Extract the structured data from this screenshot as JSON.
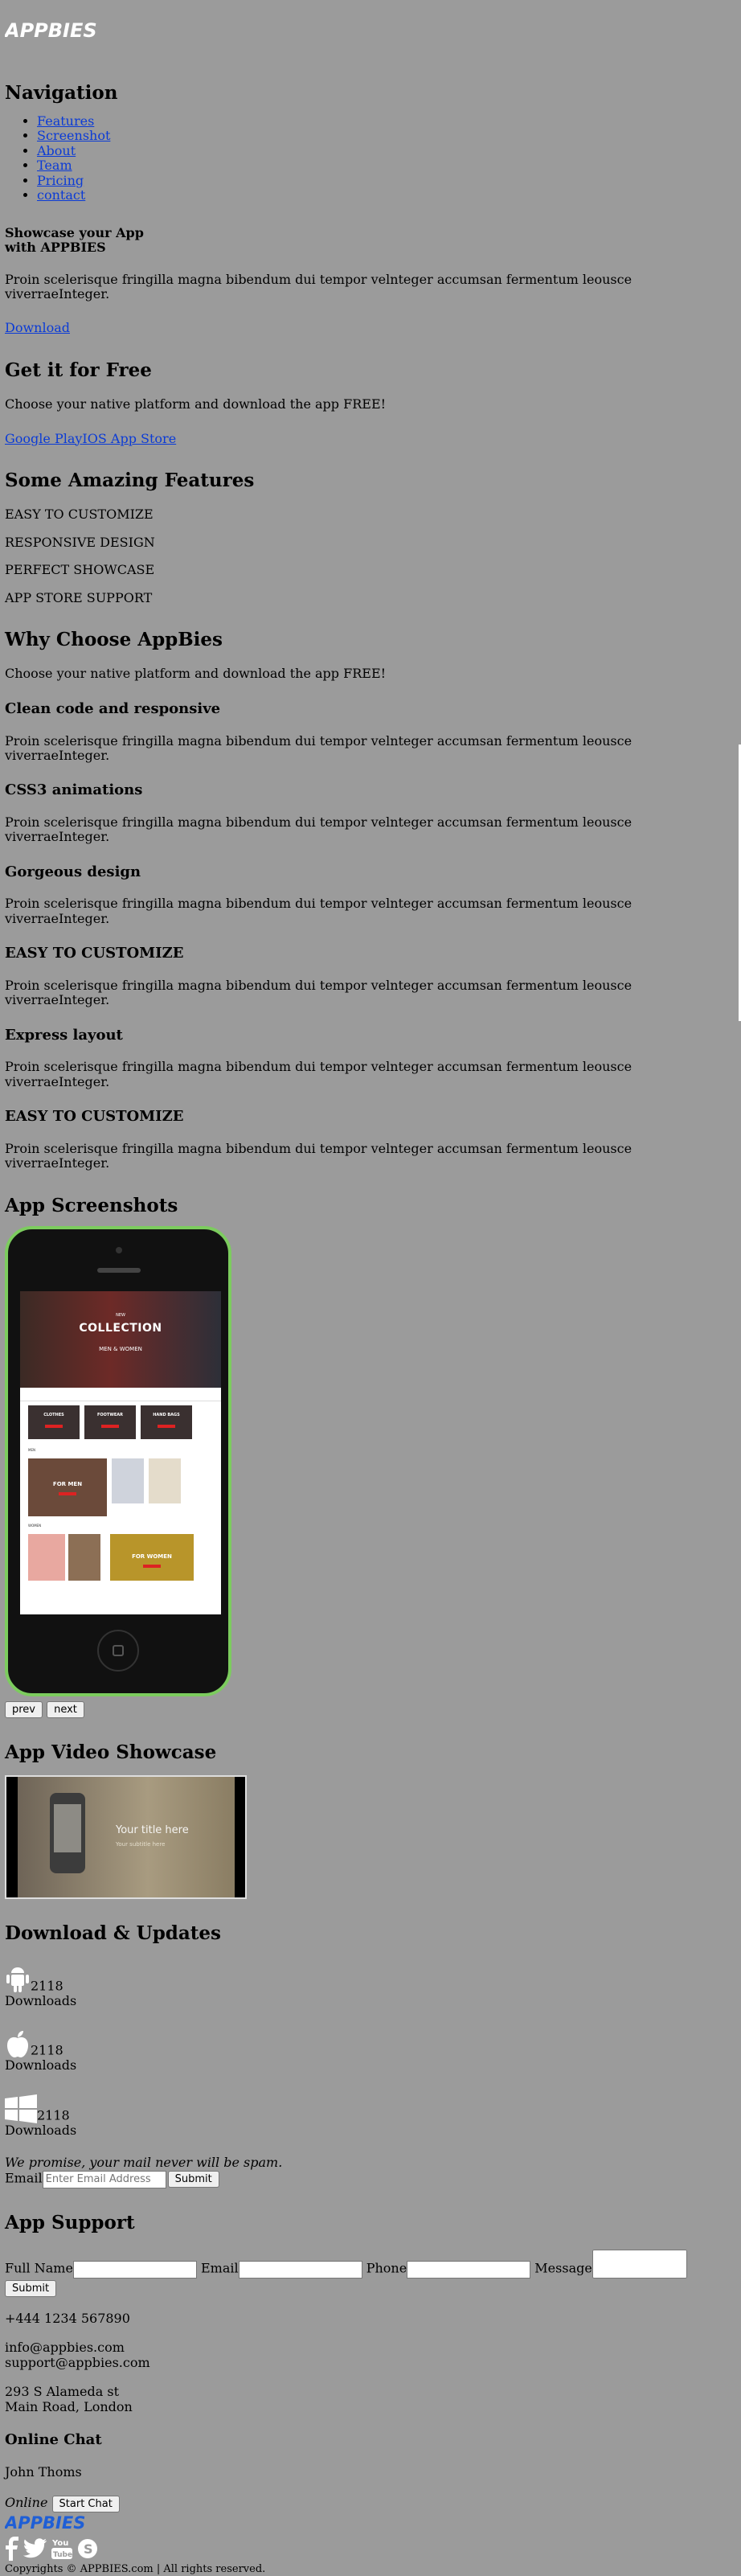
{
  "brand": {
    "name": "APPBIES"
  },
  "nav": {
    "heading": "Navigation",
    "items": [
      "Features",
      "Screenshot",
      "About",
      "Team",
      "Pricing",
      "contact"
    ]
  },
  "hero": {
    "title_line1": "Showcase your App",
    "title_line2": "with APPBIES",
    "text": "Proin scelerisque fringilla magna bibendum dui tempor velnteger accumsan fermentum leousce viverraeInteger.",
    "download_label": "Download"
  },
  "free": {
    "heading": "Get it for Free",
    "text": "Choose your native platform and download the app FREE!",
    "google_label": "Google Play",
    "ios_label": "IOS App Store"
  },
  "features": {
    "heading": "Some Amazing Features",
    "items": [
      "EASY TO CUSTOMIZE",
      "RESPONSIVE DESIGN",
      "PERFECT SHOWCASE",
      "APP STORE SUPPORT"
    ]
  },
  "why": {
    "heading": "Why Choose AppBies",
    "text": "Choose your native platform and download the app FREE!",
    "items": [
      {
        "title": "Clean code and responsive",
        "text": "Proin scelerisque fringilla magna bibendum dui tempor velnteger accumsan fermentum leousce viverraeInteger."
      },
      {
        "title": "CSS3 animations",
        "text": "Proin scelerisque fringilla magna bibendum dui tempor velnteger accumsan fermentum leousce viverraeInteger."
      },
      {
        "title": "Gorgeous design",
        "text": "Proin scelerisque fringilla magna bibendum dui tempor velnteger accumsan fermentum leousce viverraeInteger."
      },
      {
        "title": "EASY TO CUSTOMIZE",
        "text": "Proin scelerisque fringilla magna bibendum dui tempor velnteger accumsan fermentum leousce viverraeInteger."
      },
      {
        "title": "Express layout",
        "text": "Proin scelerisque fringilla magna bibendum dui tempor velnteger accumsan fermentum leousce viverraeInteger."
      },
      {
        "title": "EASY TO CUSTOMIZE",
        "text": "Proin scelerisque fringilla magna bibendum dui tempor velnteger accumsan fermentum leousce viverraeInteger."
      }
    ]
  },
  "screenshots": {
    "heading": "App Screenshots",
    "banner_small": "NEW",
    "banner_title": "COLLECTION",
    "banner_sub": "MEN & WOMEN",
    "tile1": "CLOTHES",
    "tile2": "FOOTWEAR",
    "tile3": "HAND BAGS",
    "for_men": "FOR MEN",
    "for_women": "FOR WOMEN",
    "men_label": "MEN",
    "women_label": "WOMEN",
    "prev_label": "prev",
    "next_label": "next"
  },
  "video": {
    "heading": "App Video Showcase",
    "title": "Your title here",
    "subtitle": "Your subtitle here"
  },
  "downloads": {
    "heading": "Download & Updates",
    "items": [
      {
        "icon": "android-icon",
        "count": "2118",
        "label": "Downloads"
      },
      {
        "icon": "apple-icon",
        "count": "2118",
        "label": "Downloads"
      },
      {
        "icon": "windows-icon",
        "count": "2118",
        "label": "Downloads"
      }
    ],
    "promise": "We promise, your mail never will be spam.",
    "email_label": "Email",
    "email_placeholder": "Enter Email Address",
    "submit_label": "Submit"
  },
  "support": {
    "heading": "App Support",
    "fullname_label": "Full Name",
    "email_label": "Email",
    "phone_label": "Phone",
    "message_label": "Message",
    "submit_label": "Submit",
    "phone": "+444 1234 567890",
    "email1": "info@appbies.com",
    "email2": "support@appbies.com",
    "address1": "293 S Alameda st",
    "address2": "Main Road, London"
  },
  "chat": {
    "heading": "Online Chat",
    "agent": "John Thoms",
    "status": "Online",
    "start_label": "Start Chat"
  },
  "footer": {
    "copyright": "Copyrights © APPBIES.com | All rights reserved."
  },
  "colors": {
    "background": "#9b9b9b",
    "link": "#0b3bd6",
    "phone_frame": "#7ccc5e",
    "footer_logo": "#1f5fd6"
  }
}
